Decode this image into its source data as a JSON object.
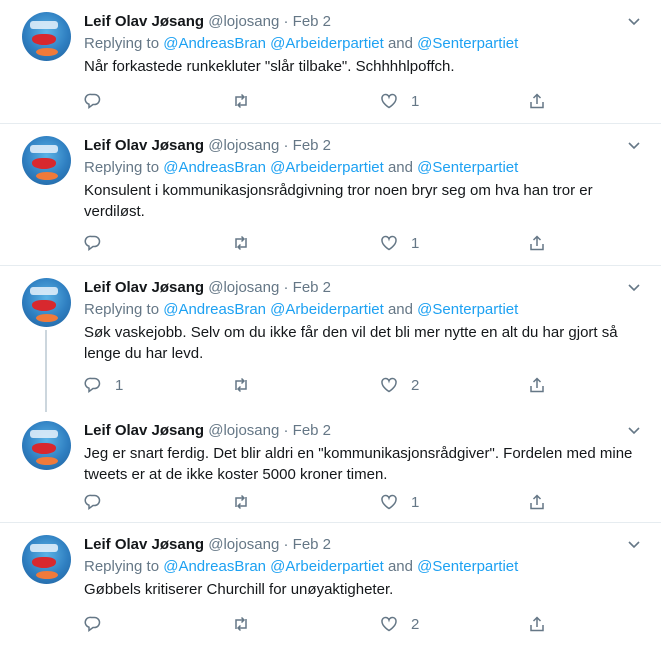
{
  "tweets": [
    {
      "name": "Leif Olav Jøsang",
      "handle": "@lojosang",
      "dot": "·",
      "date": "Feb 2",
      "replying_prefix": "Replying to ",
      "replying_mentions": [
        "@AndreasBran",
        "@Arbeiderpartiet",
        "@Senterpartiet"
      ],
      "replying_and": "and",
      "text": "Når forkastede runkekluter \"slår tilbake\". Schhhhlpoffch.",
      "reply_count": "",
      "retweet_count": "",
      "like_count": "1"
    },
    {
      "name": "Leif Olav Jøsang",
      "handle": "@lojosang",
      "dot": "·",
      "date": "Feb 2",
      "replying_prefix": "Replying to ",
      "replying_mentions": [
        "@AndreasBran",
        "@Arbeiderpartiet",
        "@Senterpartiet"
      ],
      "replying_and": "and",
      "text": "Konsulent i kommunikasjonsrådgivning tror noen bryr seg om hva han tror er verdiløst.",
      "reply_count": "",
      "retweet_count": "",
      "like_count": "1"
    },
    {
      "name": "Leif Olav Jøsang",
      "handle": "@lojosang",
      "dot": "·",
      "date": "Feb 2",
      "replying_prefix": "Replying to ",
      "replying_mentions": [
        "@AndreasBran",
        "@Arbeiderpartiet",
        "@Senterpartiet"
      ],
      "replying_and": "and",
      "text": "Søk vaskejobb. Selv om du ikke får den vil det bli mer nytte en alt du har gjort så lenge du har levd.",
      "reply_count": "1",
      "retweet_count": "",
      "like_count": "2"
    },
    {
      "name": "Leif Olav Jøsang",
      "handle": "@lojosang",
      "dot": "·",
      "date": "Feb 2",
      "text": "Jeg er snart ferdig. Det blir aldri en \"kommunikasjonsrådgiver\". Fordelen med mine tweets er at de ikke koster 5000 kroner timen.",
      "reply_count": "",
      "retweet_count": "",
      "like_count": "1"
    },
    {
      "name": "Leif Olav Jøsang",
      "handle": "@lojosang",
      "dot": "·",
      "date": "Feb 2",
      "replying_prefix": "Replying to ",
      "replying_mentions": [
        "@AndreasBran",
        "@Arbeiderpartiet",
        "@Senterpartiet"
      ],
      "replying_and": "and",
      "text": "Gøbbels kritiserer Churchill for unøyaktigheter.",
      "reply_count": "",
      "retweet_count": "",
      "like_count": "2"
    }
  ],
  "colors": {
    "link": "#1da1f2",
    "muted": "#657786",
    "text": "#14171a",
    "border": "#e6ecf0"
  },
  "icons": [
    "reply-icon",
    "retweet-icon",
    "like-icon",
    "share-icon",
    "chevron-down-icon"
  ]
}
